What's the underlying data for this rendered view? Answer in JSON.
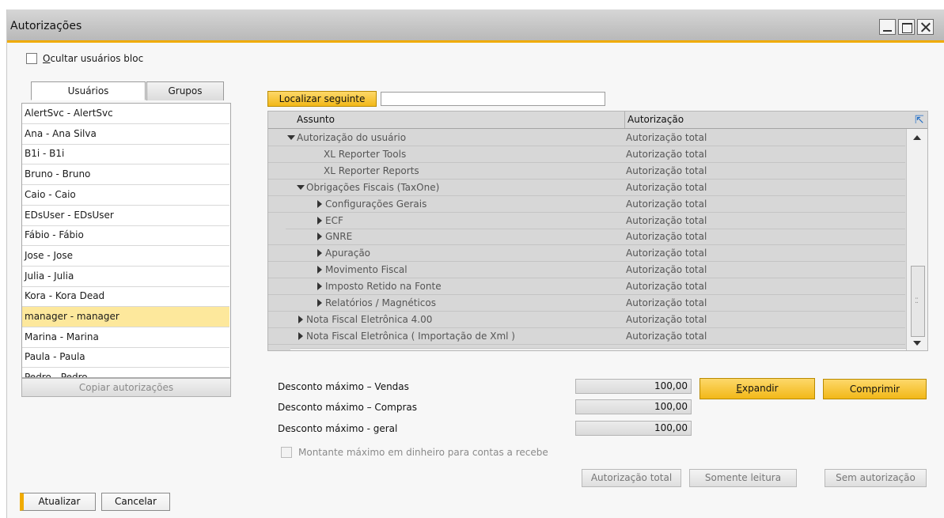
{
  "window": {
    "title": "Autorizações"
  },
  "hide_blocked": {
    "label": "Ocultar usuários bloc",
    "checked": false
  },
  "tabs": [
    {
      "label": "Usuários"
    },
    {
      "label": "Grupos"
    }
  ],
  "users": [
    {
      "label": "AlertSvc - AlertSvc"
    },
    {
      "label": "Ana - Ana Silva"
    },
    {
      "label": "B1i - B1i"
    },
    {
      "label": "Bruno - Bruno"
    },
    {
      "label": "Caio - Caio"
    },
    {
      "label": "EDsUser - EDsUser"
    },
    {
      "label": "Fábio - Fábio"
    },
    {
      "label": "Jose - Jose"
    },
    {
      "label": "Julia - Julia"
    },
    {
      "label": "Kora - Kora Dead"
    },
    {
      "label": "manager - manager",
      "selected": true
    },
    {
      "label": "Marina - Marina"
    },
    {
      "label": "Paula - Paula"
    },
    {
      "label": "Pedro - Pedro"
    }
  ],
  "copy_button": {
    "label": "Copiar autorizações"
  },
  "find": {
    "button_label": "Localizar seguinte",
    "value": ""
  },
  "grid": {
    "columns": {
      "subject": "Assunto",
      "authorization": "Autorização"
    },
    "rows": [
      {
        "subject": "Autorização do usuário",
        "authorization": "Autorização total",
        "level": 0,
        "expander": "expanded"
      },
      {
        "subject": "XL Reporter Tools",
        "authorization": "Autorização total",
        "level": 1,
        "expander": "none"
      },
      {
        "subject": "XL Reporter Reports",
        "authorization": "Autorização total",
        "level": 1,
        "expander": "none"
      },
      {
        "subject": "Obrigações Fiscais (TaxOne)",
        "authorization": "Autorização total",
        "level": 1,
        "expander": "expanded"
      },
      {
        "subject": "Configurações Gerais",
        "authorization": "Autorização total",
        "level": 2,
        "expander": "collapsed"
      },
      {
        "subject": "ECF",
        "authorization": "Autorização total",
        "level": 2,
        "expander": "collapsed"
      },
      {
        "subject": "GNRE",
        "authorization": "Autorização total",
        "level": 2,
        "expander": "collapsed"
      },
      {
        "subject": "Apuração",
        "authorization": "Autorização total",
        "level": 2,
        "expander": "collapsed"
      },
      {
        "subject": "Movimento Fiscal",
        "authorization": "Autorização total",
        "level": 2,
        "expander": "collapsed"
      },
      {
        "subject": "Imposto Retido na Fonte",
        "authorization": "Autorização total",
        "level": 2,
        "expander": "collapsed"
      },
      {
        "subject": "Relatórios / Magnéticos",
        "authorization": "Autorização total",
        "level": 2,
        "expander": "collapsed"
      },
      {
        "subject": "Nota Fiscal Eletrônica 4.00",
        "authorization": "Autorização total",
        "level": 1,
        "expander": "collapsed"
      },
      {
        "subject": "Nota Fiscal Eletrônica ( Importação de Xml )",
        "authorization": "Autorização total",
        "level": 1,
        "expander": "collapsed"
      }
    ]
  },
  "discounts": [
    {
      "label": "Desconto máximo – Vendas",
      "value": "100,00"
    },
    {
      "label": "Desconto máximo – Compras",
      "value": "100,00"
    },
    {
      "label": "Desconto máximo - geral",
      "value": "100,00"
    }
  ],
  "expand_button": {
    "label": "Expandir"
  },
  "collapse_button": {
    "label": "Comprimir"
  },
  "max_cash": {
    "label": "Montante máximo em dinheiro para contas a recebe",
    "checked": false,
    "enabled": false
  },
  "auth_buttons": {
    "full": "Autorização total",
    "read_only": "Somente leitura",
    "none": "Sem autorização"
  },
  "footer": {
    "update": "Atualizar",
    "cancel": "Cancelar"
  },
  "colors": {
    "accent": "#f0ab00",
    "selection": "#fde89c",
    "button_yellow": "#f2b818"
  }
}
